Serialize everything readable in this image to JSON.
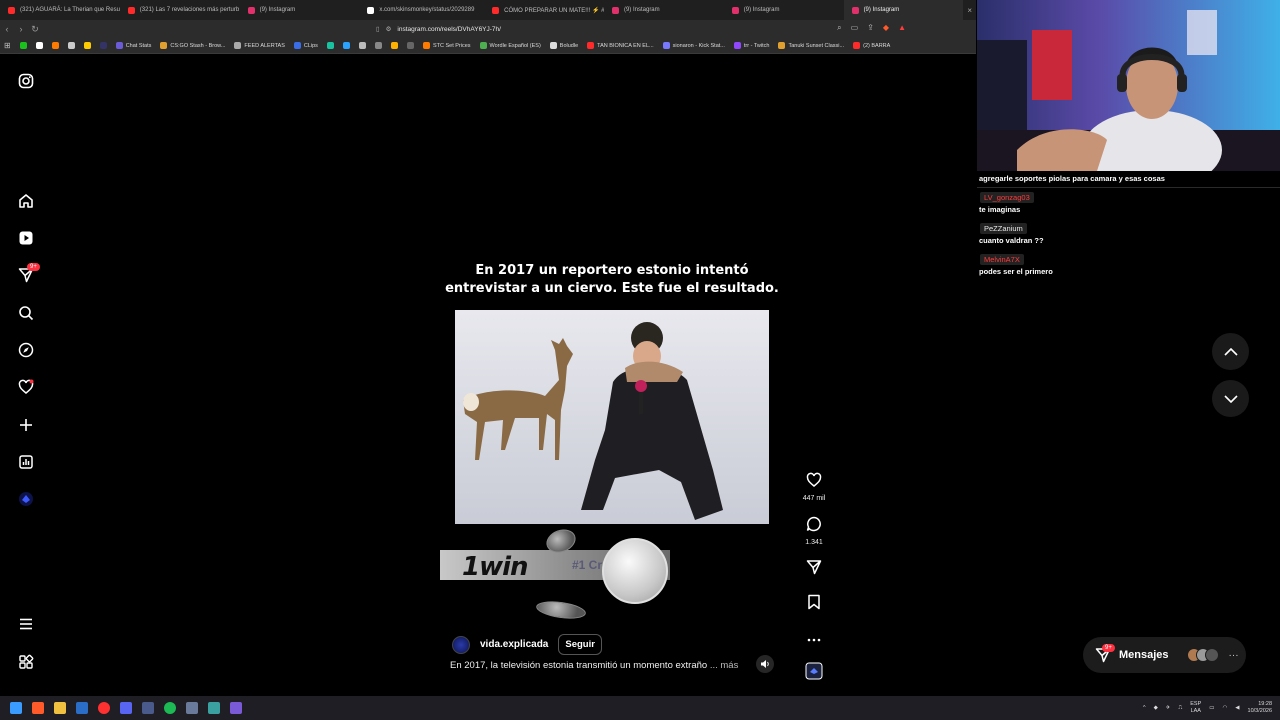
{
  "browser": {
    "tabs": [
      {
        "label": "(321) AGUARÁ: La Therian que Result",
        "color": "#ff2a2a"
      },
      {
        "label": "(321) Las 7 revelaciones más perturb",
        "color": "#ff2a2a"
      },
      {
        "label": "(9) Instagram",
        "color": "#e1306c"
      },
      {
        "label": "x.com/skinsmonkey/status/2029289",
        "color": "#ffffff"
      },
      {
        "label": "CÓMO PREPARAR UN MATE!!! ⚡ #e",
        "color": "#ff2a2a"
      },
      {
        "label": "(9) Instagram",
        "color": "#e1306c"
      },
      {
        "label": "(9) Instagram",
        "color": "#e1306c"
      },
      {
        "label": "(9) Instagram",
        "color": "#e1306c",
        "active": true
      }
    ],
    "url": "instagram.com/reels/DVhAY6YJ-7h/",
    "bookmarks": [
      {
        "label": "",
        "color": "#19c31b"
      },
      {
        "label": "",
        "color": "#ffffff"
      },
      {
        "label": "",
        "color": "#ff7a00"
      },
      {
        "label": "",
        "color": "#cccccc"
      },
      {
        "label": "",
        "color": "#ffcc00"
      },
      {
        "label": "",
        "color": "#333366"
      },
      {
        "label": "Chat Stats",
        "color": "#6b5bd6"
      },
      {
        "label": "CS:GO Stash - Brow...",
        "color": "#e0a030"
      },
      {
        "label": "FEED ALERTAS",
        "color": "#aaaaaa"
      },
      {
        "label": "CLips",
        "color": "#3a6ee8"
      },
      {
        "label": "",
        "color": "#19c3a0"
      },
      {
        "label": "",
        "color": "#29a3ff"
      },
      {
        "label": "",
        "color": "#bbbbbb"
      },
      {
        "label": "",
        "color": "#888888"
      },
      {
        "label": "",
        "color": "#ffb300"
      },
      {
        "label": "",
        "color": "#666666"
      },
      {
        "label": "STC Set Prices",
        "color": "#ff7a00"
      },
      {
        "label": "Wordle Español (ES)",
        "color": "#4caf50"
      },
      {
        "label": "Boludle",
        "color": "#dddddd"
      },
      {
        "label": "TAN BIONICA EN EL...",
        "color": "#ff2a2a"
      },
      {
        "label": "sionaron - Kick Stat...",
        "color": "#7777ff"
      },
      {
        "label": "trr - Twitch",
        "color": "#9146ff"
      },
      {
        "label": "Tanuki Sunset Classi...",
        "color": "#e0a030"
      },
      {
        "label": "(2) BARRA",
        "color": "#ff2a2a"
      }
    ]
  },
  "reel": {
    "caption_line1": "En 2017 un reportero estonio intentó",
    "caption_line2": "entrevistar a un ciervo. Este fue el resultado.",
    "ad_logo": "1win",
    "ad_tag": "#1 Cr",
    "account": "vida.explicada",
    "follow_label": "Seguir",
    "description": "En 2017, la televisión estonia transmitió un momento extraño",
    "more_label": "... más",
    "likes": "447 mil",
    "comments": "1.341"
  },
  "messages": {
    "label": "Mensajes",
    "badge": "9+"
  },
  "nav": {
    "notifications_badge": "9+"
  },
  "chat": {
    "line1": "agregarle soportes piolas para camara y esas cosas",
    "user2": "LV_gonzag03",
    "user2_color": "#ff3b3b",
    "msg2": "te imaginas",
    "user3": "PeZZanium",
    "user3_color": "#e8e8e8",
    "msg3": "cuanto valdran ??",
    "user4": "MelvinA7X",
    "user4_color": "#ff3b3b",
    "msg4": "podes ser el primero"
  },
  "taskbar": {
    "lang1": "ESP",
    "lang2": "LAA",
    "time": "19:28",
    "date": "10/3/2026"
  },
  "colors": {
    "accent": "#ff3040",
    "background": "#000000"
  }
}
